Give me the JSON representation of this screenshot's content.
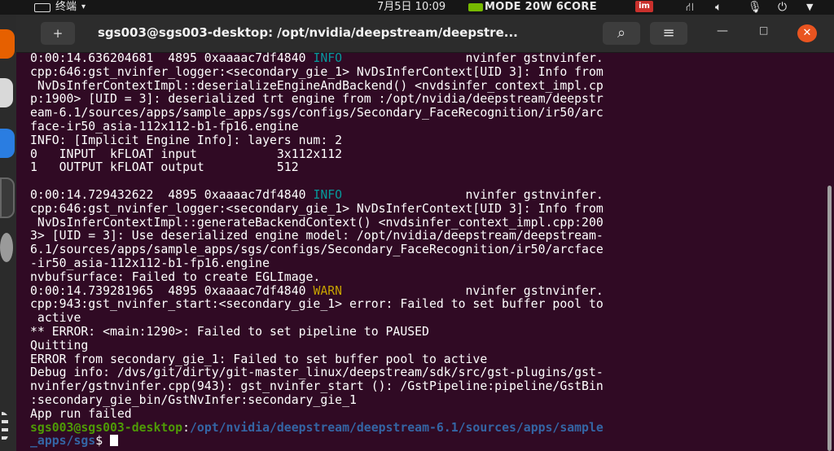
{
  "topbar": {
    "app_name": "终端",
    "app_caret": "▾",
    "clock": "7月5日  10:09",
    "power_mode": "MODE 20W 6CORE",
    "im_badge": "im",
    "icons": [
      "network-icon",
      "volume-icon",
      "mic-icon",
      "power-icon",
      "chevron-down-icon"
    ]
  },
  "window": {
    "title": "sgs003@sgs003-desktop: /opt/nvidia/deepstream/deepstre...",
    "new_tab_glyph": "+",
    "search_glyph": "⌕",
    "menu_glyph": "≡",
    "minimize_glyph": "—",
    "maximize_glyph": "□",
    "close_glyph": "✕"
  },
  "terminal": {
    "lines": [
      {
        "pre": "0:00:14.636204681  4895 0xaaaac7df4840 ",
        "level": "INFO",
        "post": "                 nvinfer gstnvinfer."
      },
      {
        "text": "cpp:646:gst_nvinfer_logger:<secondary_gie_1> NvDsInferContext[UID 3]: Info from"
      },
      {
        "text": " NvDsInferContextImpl::deserializeEngineAndBackend() <nvdsinfer_context_impl.cp"
      },
      {
        "text": "p:1900> [UID = 3]: deserialized trt engine from :/opt/nvidia/deepstream/deepstr"
      },
      {
        "text": "eam-6.1/sources/apps/sample_apps/sgs/configs/Secondary_FaceRecognition/ir50/arc"
      },
      {
        "text": "face-ir50_asia-112x112-b1-fp16.engine"
      },
      {
        "text": "INFO: [Implicit Engine Info]: layers num: 2"
      },
      {
        "text": "0   INPUT  kFLOAT input           3x112x112"
      },
      {
        "text": "1   OUTPUT kFLOAT output          512"
      },
      {
        "text": ""
      },
      {
        "pre": "0:00:14.729432622  4895 0xaaaac7df4840 ",
        "level": "INFO",
        "post": "                 nvinfer gstnvinfer."
      },
      {
        "text": "cpp:646:gst_nvinfer_logger:<secondary_gie_1> NvDsInferContext[UID 3]: Info from"
      },
      {
        "text": " NvDsInferContextImpl::generateBackendContext() <nvdsinfer_context_impl.cpp:200"
      },
      {
        "text": "3> [UID = 3]: Use deserialized engine model: /opt/nvidia/deepstream/deepstream-"
      },
      {
        "text": "6.1/sources/apps/sample_apps/sgs/configs/Secondary_FaceRecognition/ir50/arcface"
      },
      {
        "text": "-ir50_asia-112x112-b1-fp16.engine"
      },
      {
        "text": "nvbufsurface: Failed to create EGLImage."
      },
      {
        "pre": "0:00:14.739281965  4895 0xaaaac7df4840 ",
        "level": "WARN",
        "post": "                 nvinfer gstnvinfer."
      },
      {
        "text": "cpp:943:gst_nvinfer_start:<secondary_gie_1> error: Failed to set buffer pool to"
      },
      {
        "text": " active"
      },
      {
        "text": "** ERROR: <main:1290>: Failed to set pipeline to PAUSED"
      },
      {
        "text": "Quitting"
      },
      {
        "text": "ERROR from secondary_gie_1: Failed to set buffer pool to active"
      },
      {
        "text": "Debug info: /dvs/git/dirty/git-master_linux/deepstream/sdk/src/gst-plugins/gst-"
      },
      {
        "text": "nvinfer/gstnvinfer.cpp(943): gst_nvinfer_start (): /GstPipeline:pipeline/GstBin"
      },
      {
        "text": ":secondary_gie_bin/GstNvInfer:secondary_gie_1"
      },
      {
        "text": "App run failed"
      },
      {
        "user": "sgs003@sgs003-desktop",
        "colon": ":",
        "path": "/opt/nvidia/deepstream/deepstream-6.1/sources/apps/sample"
      },
      {
        "path": "_apps/sgs",
        "dollar": "$ ",
        "cursor": true
      }
    ]
  },
  "colors": {
    "terminal_bg": "#300a24",
    "info": "#06989a",
    "warn": "#c4a000",
    "prompt_user": "#4e9a06",
    "prompt_path": "#3465a4",
    "close_button": "#e95420"
  }
}
